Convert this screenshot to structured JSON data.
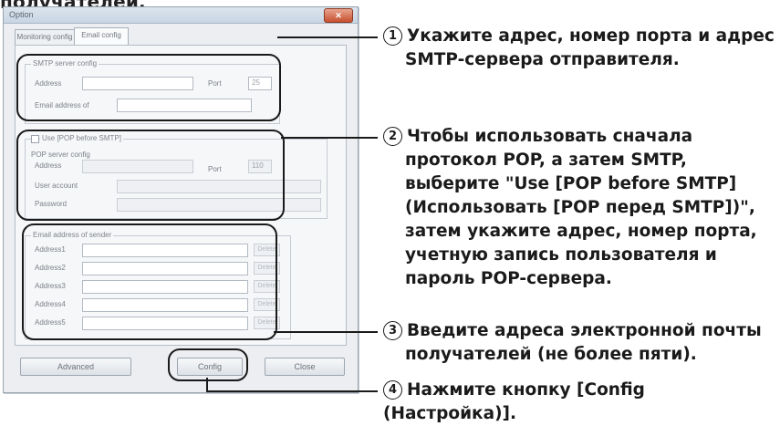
{
  "heading": "получателей.",
  "dialog": {
    "title": "Option",
    "close_label": "✕",
    "tabs": [
      {
        "label": "Monitoring config"
      },
      {
        "label": "Email config"
      }
    ],
    "smtp": {
      "group_title": "SMTP server config",
      "address_label": "Address",
      "port_label": "Port",
      "port_value": "25",
      "email_label": "Email address of"
    },
    "pop": {
      "use_label": "Use [POP before SMTP]",
      "group_title": "POP server config",
      "address_label": "Address",
      "port_label": "Port",
      "port_value": "110",
      "user_label": "User account",
      "password_label": "Password"
    },
    "recipients": {
      "group_title": "Email address of sender",
      "rows": [
        {
          "label": "Address1",
          "button": "Delete"
        },
        {
          "label": "Address2",
          "button": "Delete"
        },
        {
          "label": "Address3",
          "button": "Delete"
        },
        {
          "label": "Address4",
          "button": "Delete"
        },
        {
          "label": "Address5",
          "button": "Delete"
        }
      ]
    },
    "buttons": {
      "advanced": "Advanced",
      "config": "Config",
      "close": "Close"
    }
  },
  "annotations": [
    {
      "num": "1",
      "lines": [
        "Укажите адрес, номер порта и адрес",
        "SMTP-сервера отправителя."
      ]
    },
    {
      "num": "2",
      "lines": [
        "Чтобы использовать сначала",
        "протокол POP, а затем SMTP,",
        "выберите \"Use [POP before SMTP]",
        "(Использовать [POP перед SMTP])\",",
        "затем укажите адрес, номер порта,",
        "учетную запись пользователя и",
        "пароль POP-сервера."
      ]
    },
    {
      "num": "3",
      "lines": [
        "Введите адреса электронной почты",
        "получателей (не более пяти)."
      ]
    },
    {
      "num": "4",
      "lines": [
        "Нажмите кнопку [Config (Настройка)]."
      ]
    }
  ]
}
